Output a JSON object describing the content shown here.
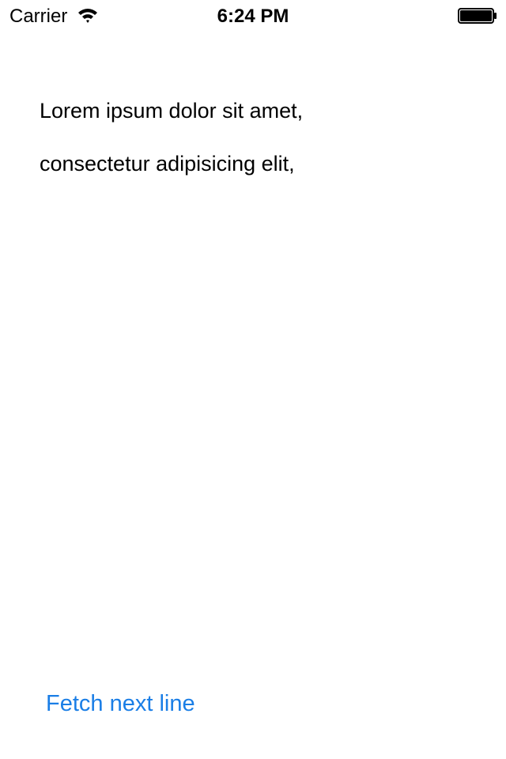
{
  "status_bar": {
    "carrier": "Carrier",
    "time": "6:24 PM",
    "wifi_icon": "wifi-icon",
    "battery_icon": "battery-icon",
    "battery_level": 1.0
  },
  "content": {
    "lines": [
      "Lorem ipsum dolor sit amet,",
      "consectetur adipisicing elit,"
    ]
  },
  "actions": {
    "fetch_label": "Fetch next line"
  },
  "colors": {
    "accent": "#1a7ee6",
    "text": "#000000",
    "background": "#ffffff"
  }
}
